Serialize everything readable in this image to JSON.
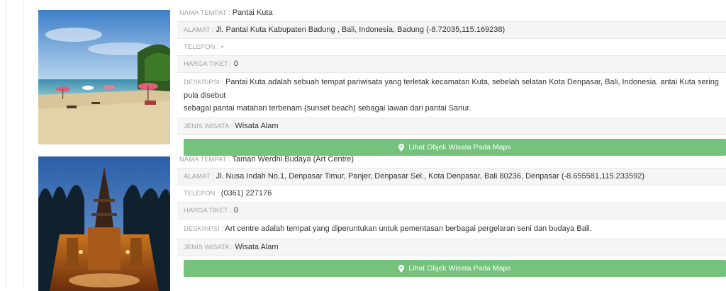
{
  "colors": {
    "button": "#74c27c",
    "label": "#a3a3a3",
    "value": "#333333",
    "row_alt": "#f5f5f5"
  },
  "places": [
    {
      "nama_label": "NAMA TEMPAT :",
      "nama": "Pantai Kuta",
      "alamat_label": "ALAMAT :",
      "alamat": "Jl. Pantai Kuta Kabupaten Badung , Bali, Indonesia, Badung (-8.72035,115.169238)",
      "telepon_label": "TELEPON :",
      "telepon": "-",
      "harga_label": "HARGA TIKET :",
      "harga": "0",
      "deskripsi_label": "DESKRIPSI :",
      "deskripsi_line1": "Pantai Kuta adalah sebuah tempat pariwisata yang terletak kecamatan Kuta, sebelah selatan Kota Denpasar, Bali, Indonesia. antai Kuta sering pula disebut",
      "deskripsi_line2": "sebagai pantai matahari terbenam (sunset beach) sebagai lawan dari pantai Sanur.",
      "jenis_label": "JENIS WISATA :",
      "jenis": "Wisata Alam",
      "button_label": "Lihat Objek Wisata Pada Maps",
      "photo_icon": "beach-photo"
    },
    {
      "nama_label": "NAMA TEMPAT :",
      "nama": "Taman Werdhi Budaya (Art Centre)",
      "alamat_label": "ALAMAT :",
      "alamat": "Jl. Nusa Indah No.1, Denpasar Timur, Panjer, Denpasar Sel., Kota Denpasar, Bali 80236, Denpasar (-8.655581,115.233592)",
      "telepon_label": "TELEPON :",
      "telepon": "(0361) 227176",
      "harga_label": "HARGA TIKET :",
      "harga": "0",
      "deskripsi_label": "DESKRIPSI :",
      "deskripsi_line1": "Art centre adalah tempat yang diperuntukan untuk pementasan berbagai pergelaran seni dan budaya Bali.",
      "jenis_label": "JENIS WISATA :",
      "jenis": "Wisata Alam",
      "button_label": "Lihat Objek Wisata Pada Maps",
      "photo_icon": "temple-photo"
    }
  ]
}
